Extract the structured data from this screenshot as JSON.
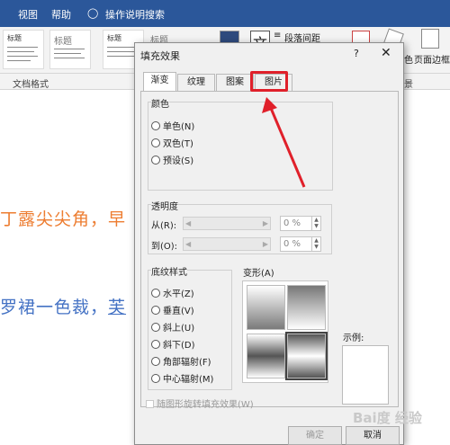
{
  "menubar": {
    "tab_view": "视图",
    "tab_help": "帮助",
    "tell_me": "操作说明搜索"
  },
  "ribbon": {
    "style_title": "标题",
    "paragraph_spacing": "段落间距",
    "page_border_label": "页面边框",
    "color_label": "色",
    "text_label": "文"
  },
  "groupbar": {
    "doc_format": "文档格式",
    "background": "景"
  },
  "document": {
    "line1": "丁露尖尖角，早",
    "line2_prefix": "罗裙一色裁，",
    "line2_link": "芙"
  },
  "dialog": {
    "title": "填充效果",
    "help": "?",
    "close": "✕",
    "tabs": [
      "渐变",
      "纹理",
      "图案",
      "图片"
    ],
    "active_tab": 0,
    "highlight_tab": 3,
    "colors": {
      "label": "颜色",
      "options": [
        "单色(N)",
        "双色(T)",
        "预设(S)"
      ]
    },
    "transparency": {
      "label": "透明度",
      "from_label": "从(R):",
      "to_label": "到(O):",
      "from_value": "0 %",
      "to_value": "0 %"
    },
    "shading": {
      "label": "底纹样式",
      "options": [
        "水平(Z)",
        "垂直(V)",
        "斜上(U)",
        "斜下(D)",
        "角部辐射(F)",
        "中心辐射(M)"
      ]
    },
    "variants_label": "变形(A)",
    "sample_label": "示例:",
    "rotate_checkbox": "随图形旋转填充效果(W)",
    "ok_button": "确定",
    "cancel_button": "取消"
  },
  "watermark": "Bai度 经验",
  "accent_colors": {
    "word_blue": "#2b579a",
    "annotation_red": "#e0202a",
    "doc_orange": "#ed7d31",
    "doc_blue": "#4472c4"
  }
}
